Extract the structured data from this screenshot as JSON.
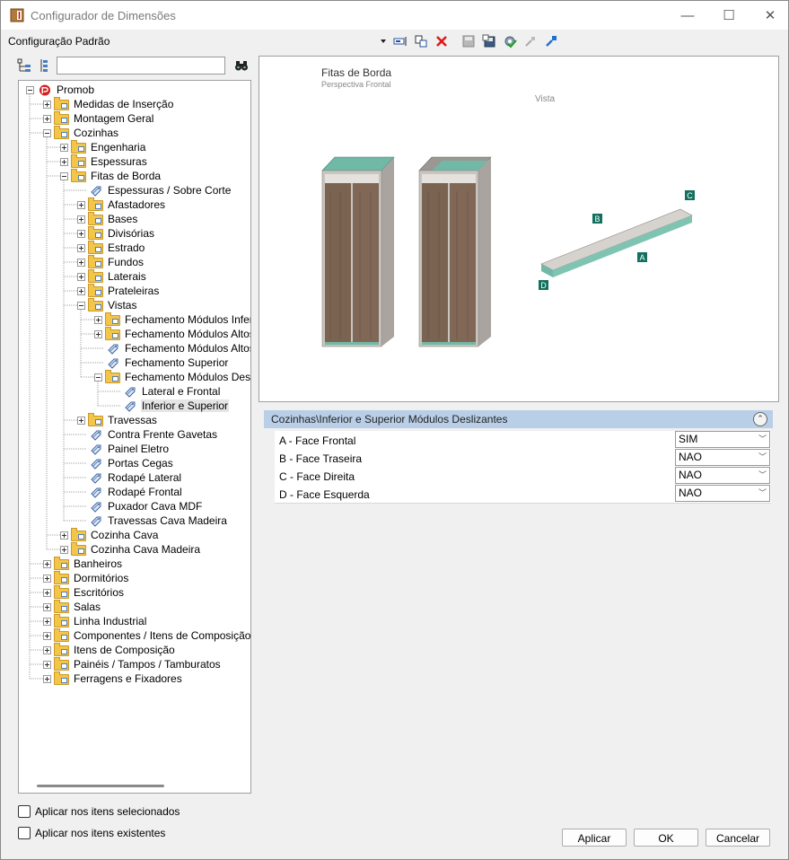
{
  "window": {
    "title": "Configurador de Dimensões",
    "minimize": "—",
    "maximize": "☐",
    "close": "✕"
  },
  "toolbar": {
    "config_name": "Configuração Padrão"
  },
  "tree_search": {
    "value": "",
    "placeholder": ""
  },
  "tree": [
    {
      "label": "Promob",
      "depth": 0,
      "exp": "minus",
      "icon": "promob"
    },
    {
      "label": "Medidas de Inserção",
      "depth": 1,
      "exp": "plus",
      "icon": "folder"
    },
    {
      "label": "Montagem Geral",
      "depth": 1,
      "exp": "plus",
      "icon": "folder"
    },
    {
      "label": "Cozinhas",
      "depth": 1,
      "exp": "minus",
      "icon": "folder"
    },
    {
      "label": "Engenharia",
      "depth": 2,
      "exp": "plus",
      "icon": "folder"
    },
    {
      "label": "Espessuras",
      "depth": 2,
      "exp": "plus",
      "icon": "folder"
    },
    {
      "label": "Fitas de Borda",
      "depth": 2,
      "exp": "minus",
      "icon": "folder"
    },
    {
      "label": "Espessuras / Sobre Corte",
      "depth": 3,
      "exp": "none",
      "icon": "tag"
    },
    {
      "label": "Afastadores",
      "depth": 3,
      "exp": "plus",
      "icon": "folder"
    },
    {
      "label": "Bases",
      "depth": 3,
      "exp": "plus",
      "icon": "folder"
    },
    {
      "label": "Divisórias",
      "depth": 3,
      "exp": "plus",
      "icon": "folder"
    },
    {
      "label": "Estrado",
      "depth": 3,
      "exp": "plus",
      "icon": "folder"
    },
    {
      "label": "Fundos",
      "depth": 3,
      "exp": "plus",
      "icon": "folder"
    },
    {
      "label": "Laterais",
      "depth": 3,
      "exp": "plus",
      "icon": "folder"
    },
    {
      "label": "Prateleiras",
      "depth": 3,
      "exp": "plus",
      "icon": "folder"
    },
    {
      "label": "Vistas",
      "depth": 3,
      "exp": "minus",
      "icon": "folder"
    },
    {
      "label": "Fechamento Módulos Inferior",
      "depth": 4,
      "exp": "plus",
      "icon": "folder"
    },
    {
      "label": "Fechamento Módulos Altos e",
      "depth": 4,
      "exp": "plus",
      "icon": "folder"
    },
    {
      "label": "Fechamento Módulos Altos",
      "depth": 4,
      "exp": "none",
      "icon": "tag"
    },
    {
      "label": "Fechamento Superior",
      "depth": 4,
      "exp": "none",
      "icon": "tag"
    },
    {
      "label": "Fechamento Módulos Desliza",
      "depth": 4,
      "exp": "minus",
      "icon": "folder"
    },
    {
      "label": "Lateral e Frontal",
      "depth": 5,
      "exp": "none",
      "icon": "tag"
    },
    {
      "label": "Inferior e Superior",
      "depth": 5,
      "exp": "none",
      "icon": "tag",
      "selected": true
    },
    {
      "label": "Travessas",
      "depth": 3,
      "exp": "plus",
      "icon": "folder"
    },
    {
      "label": "Contra Frente Gavetas",
      "depth": 3,
      "exp": "none",
      "icon": "tag"
    },
    {
      "label": "Painel Eletro",
      "depth": 3,
      "exp": "none",
      "icon": "tag"
    },
    {
      "label": "Portas Cegas",
      "depth": 3,
      "exp": "none",
      "icon": "tag"
    },
    {
      "label": "Rodapé Lateral",
      "depth": 3,
      "exp": "none",
      "icon": "tag"
    },
    {
      "label": "Rodapé Frontal",
      "depth": 3,
      "exp": "none",
      "icon": "tag"
    },
    {
      "label": "Puxador Cava MDF",
      "depth": 3,
      "exp": "none",
      "icon": "tag"
    },
    {
      "label": "Travessas Cava Madeira",
      "depth": 3,
      "exp": "none",
      "icon": "tag"
    },
    {
      "label": "Cozinha Cava",
      "depth": 2,
      "exp": "plus",
      "icon": "folder"
    },
    {
      "label": "Cozinha Cava Madeira",
      "depth": 2,
      "exp": "plus",
      "icon": "folder"
    },
    {
      "label": "Banheiros",
      "depth": 1,
      "exp": "plus",
      "icon": "folder"
    },
    {
      "label": "Dormitórios",
      "depth": 1,
      "exp": "plus",
      "icon": "folder"
    },
    {
      "label": "Escritórios",
      "depth": 1,
      "exp": "plus",
      "icon": "folder"
    },
    {
      "label": "Salas",
      "depth": 1,
      "exp": "plus",
      "icon": "folder"
    },
    {
      "label": "Linha Industrial",
      "depth": 1,
      "exp": "plus",
      "icon": "folder"
    },
    {
      "label": "Componentes / Itens de Composição",
      "depth": 1,
      "exp": "plus",
      "icon": "folder"
    },
    {
      "label": "Itens de Composição",
      "depth": 1,
      "exp": "plus",
      "icon": "folder"
    },
    {
      "label": "Painéis / Tampos / Tamburatos",
      "depth": 1,
      "exp": "plus",
      "icon": "folder"
    },
    {
      "label": "Ferragens e Fixadores",
      "depth": 1,
      "exp": "plus",
      "icon": "folder"
    }
  ],
  "preview": {
    "title": "Fitas de Borda",
    "subtitle": "Perspectiva Frontal",
    "view_label": "Vista",
    "labels": {
      "a": "A",
      "b": "B",
      "c": "C",
      "d": "D"
    },
    "colors": {
      "edge_band": "#6fb9a6",
      "cabinet": "#c8c4bf",
      "wood": "#7b6352",
      "label": "#11705e"
    }
  },
  "properties": {
    "header": "Cozinhas\\Inferior e Superior Módulos Deslizantes",
    "rows": [
      {
        "name": "A - Face Frontal",
        "value": "SIM"
      },
      {
        "name": "B - Face Traseira",
        "value": "NAO"
      },
      {
        "name": "C - Face Direita",
        "value": "NAO"
      },
      {
        "name": "D - Face Esquerda",
        "value": "NAO"
      }
    ]
  },
  "options": {
    "apply_selected": "Aplicar nos itens selecionados",
    "apply_existing": "Aplicar nos itens existentes"
  },
  "buttons": {
    "apply": "Aplicar",
    "ok": "OK",
    "cancel": "Cancelar"
  }
}
